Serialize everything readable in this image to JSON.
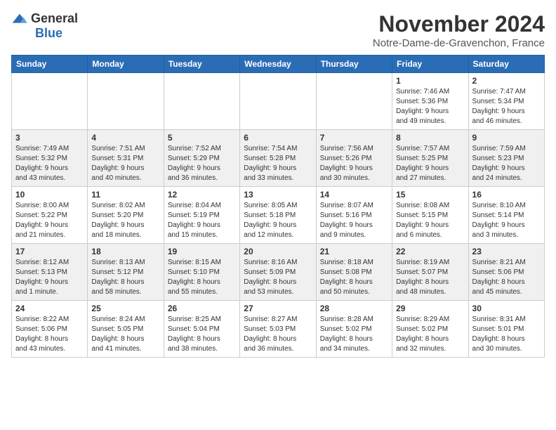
{
  "header": {
    "logo_general": "General",
    "logo_blue": "Blue",
    "month_title": "November 2024",
    "location": "Notre-Dame-de-Gravenchon, France"
  },
  "calendar": {
    "days_of_week": [
      "Sunday",
      "Monday",
      "Tuesday",
      "Wednesday",
      "Thursday",
      "Friday",
      "Saturday"
    ],
    "weeks": [
      [
        {
          "day": "",
          "info": ""
        },
        {
          "day": "",
          "info": ""
        },
        {
          "day": "",
          "info": ""
        },
        {
          "day": "",
          "info": ""
        },
        {
          "day": "",
          "info": ""
        },
        {
          "day": "1",
          "info": "Sunrise: 7:46 AM\nSunset: 5:36 PM\nDaylight: 9 hours\nand 49 minutes."
        },
        {
          "day": "2",
          "info": "Sunrise: 7:47 AM\nSunset: 5:34 PM\nDaylight: 9 hours\nand 46 minutes."
        }
      ],
      [
        {
          "day": "3",
          "info": "Sunrise: 7:49 AM\nSunset: 5:32 PM\nDaylight: 9 hours\nand 43 minutes."
        },
        {
          "day": "4",
          "info": "Sunrise: 7:51 AM\nSunset: 5:31 PM\nDaylight: 9 hours\nand 40 minutes."
        },
        {
          "day": "5",
          "info": "Sunrise: 7:52 AM\nSunset: 5:29 PM\nDaylight: 9 hours\nand 36 minutes."
        },
        {
          "day": "6",
          "info": "Sunrise: 7:54 AM\nSunset: 5:28 PM\nDaylight: 9 hours\nand 33 minutes."
        },
        {
          "day": "7",
          "info": "Sunrise: 7:56 AM\nSunset: 5:26 PM\nDaylight: 9 hours\nand 30 minutes."
        },
        {
          "day": "8",
          "info": "Sunrise: 7:57 AM\nSunset: 5:25 PM\nDaylight: 9 hours\nand 27 minutes."
        },
        {
          "day": "9",
          "info": "Sunrise: 7:59 AM\nSunset: 5:23 PM\nDaylight: 9 hours\nand 24 minutes."
        }
      ],
      [
        {
          "day": "10",
          "info": "Sunrise: 8:00 AM\nSunset: 5:22 PM\nDaylight: 9 hours\nand 21 minutes."
        },
        {
          "day": "11",
          "info": "Sunrise: 8:02 AM\nSunset: 5:20 PM\nDaylight: 9 hours\nand 18 minutes."
        },
        {
          "day": "12",
          "info": "Sunrise: 8:04 AM\nSunset: 5:19 PM\nDaylight: 9 hours\nand 15 minutes."
        },
        {
          "day": "13",
          "info": "Sunrise: 8:05 AM\nSunset: 5:18 PM\nDaylight: 9 hours\nand 12 minutes."
        },
        {
          "day": "14",
          "info": "Sunrise: 8:07 AM\nSunset: 5:16 PM\nDaylight: 9 hours\nand 9 minutes."
        },
        {
          "day": "15",
          "info": "Sunrise: 8:08 AM\nSunset: 5:15 PM\nDaylight: 9 hours\nand 6 minutes."
        },
        {
          "day": "16",
          "info": "Sunrise: 8:10 AM\nSunset: 5:14 PM\nDaylight: 9 hours\nand 3 minutes."
        }
      ],
      [
        {
          "day": "17",
          "info": "Sunrise: 8:12 AM\nSunset: 5:13 PM\nDaylight: 9 hours\nand 1 minute."
        },
        {
          "day": "18",
          "info": "Sunrise: 8:13 AM\nSunset: 5:12 PM\nDaylight: 8 hours\nand 58 minutes."
        },
        {
          "day": "19",
          "info": "Sunrise: 8:15 AM\nSunset: 5:10 PM\nDaylight: 8 hours\nand 55 minutes."
        },
        {
          "day": "20",
          "info": "Sunrise: 8:16 AM\nSunset: 5:09 PM\nDaylight: 8 hours\nand 53 minutes."
        },
        {
          "day": "21",
          "info": "Sunrise: 8:18 AM\nSunset: 5:08 PM\nDaylight: 8 hours\nand 50 minutes."
        },
        {
          "day": "22",
          "info": "Sunrise: 8:19 AM\nSunset: 5:07 PM\nDaylight: 8 hours\nand 48 minutes."
        },
        {
          "day": "23",
          "info": "Sunrise: 8:21 AM\nSunset: 5:06 PM\nDaylight: 8 hours\nand 45 minutes."
        }
      ],
      [
        {
          "day": "24",
          "info": "Sunrise: 8:22 AM\nSunset: 5:06 PM\nDaylight: 8 hours\nand 43 minutes."
        },
        {
          "day": "25",
          "info": "Sunrise: 8:24 AM\nSunset: 5:05 PM\nDaylight: 8 hours\nand 41 minutes."
        },
        {
          "day": "26",
          "info": "Sunrise: 8:25 AM\nSunset: 5:04 PM\nDaylight: 8 hours\nand 38 minutes."
        },
        {
          "day": "27",
          "info": "Sunrise: 8:27 AM\nSunset: 5:03 PM\nDaylight: 8 hours\nand 36 minutes."
        },
        {
          "day": "28",
          "info": "Sunrise: 8:28 AM\nSunset: 5:02 PM\nDaylight: 8 hours\nand 34 minutes."
        },
        {
          "day": "29",
          "info": "Sunrise: 8:29 AM\nSunset: 5:02 PM\nDaylight: 8 hours\nand 32 minutes."
        },
        {
          "day": "30",
          "info": "Sunrise: 8:31 AM\nSunset: 5:01 PM\nDaylight: 8 hours\nand 30 minutes."
        }
      ]
    ]
  }
}
